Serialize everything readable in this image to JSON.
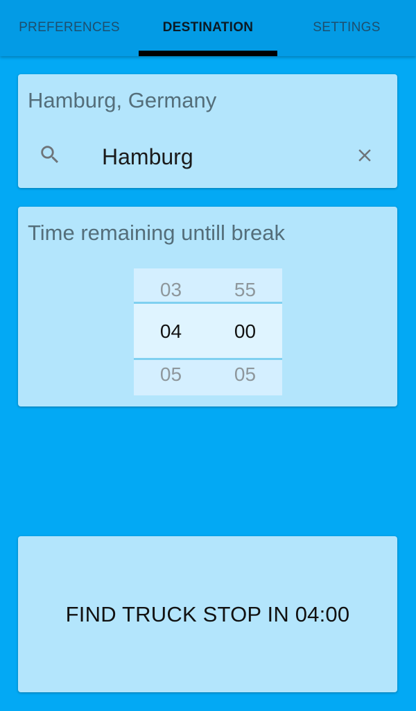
{
  "tabs": [
    {
      "label": "PREFERENCES",
      "active": false
    },
    {
      "label": "DESTINATION",
      "active": true
    },
    {
      "label": "SETTINGS",
      "active": false
    }
  ],
  "destination": {
    "title": "Hamburg, Germany",
    "search_value": "Hamburg",
    "search_icon": "search-icon",
    "clear_icon": "close-icon"
  },
  "timer": {
    "title": "Time remaining untill break",
    "hours": {
      "prev": "03",
      "current": "04",
      "next": "05"
    },
    "minutes": {
      "prev": "55",
      "current": "00",
      "next": "05"
    }
  },
  "action": {
    "label": "FIND TRUCK STOP IN 04:00"
  },
  "colors": {
    "background": "#03a9f4",
    "tabbar": "#039be5",
    "card": "#b3e5fc",
    "indicator": "#000000",
    "picker_divider": "#7fd0f0"
  }
}
